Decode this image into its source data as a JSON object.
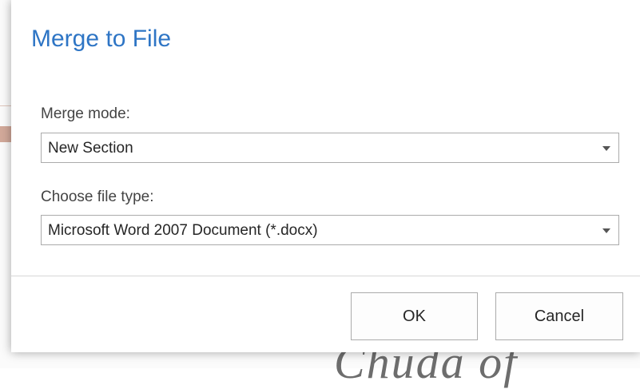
{
  "dialog": {
    "title": "Merge to File",
    "merge_mode": {
      "label": "Merge mode:",
      "value": "New Section"
    },
    "file_type": {
      "label": "Choose file type:",
      "value": "Microsoft Word 2007 Document (*.docx)"
    },
    "buttons": {
      "ok": "OK",
      "cancel": "Cancel"
    }
  },
  "colors": {
    "title": "#2e75c5",
    "border": "#ababab"
  },
  "icons": {
    "dropdown": "chevron-down-icon"
  }
}
